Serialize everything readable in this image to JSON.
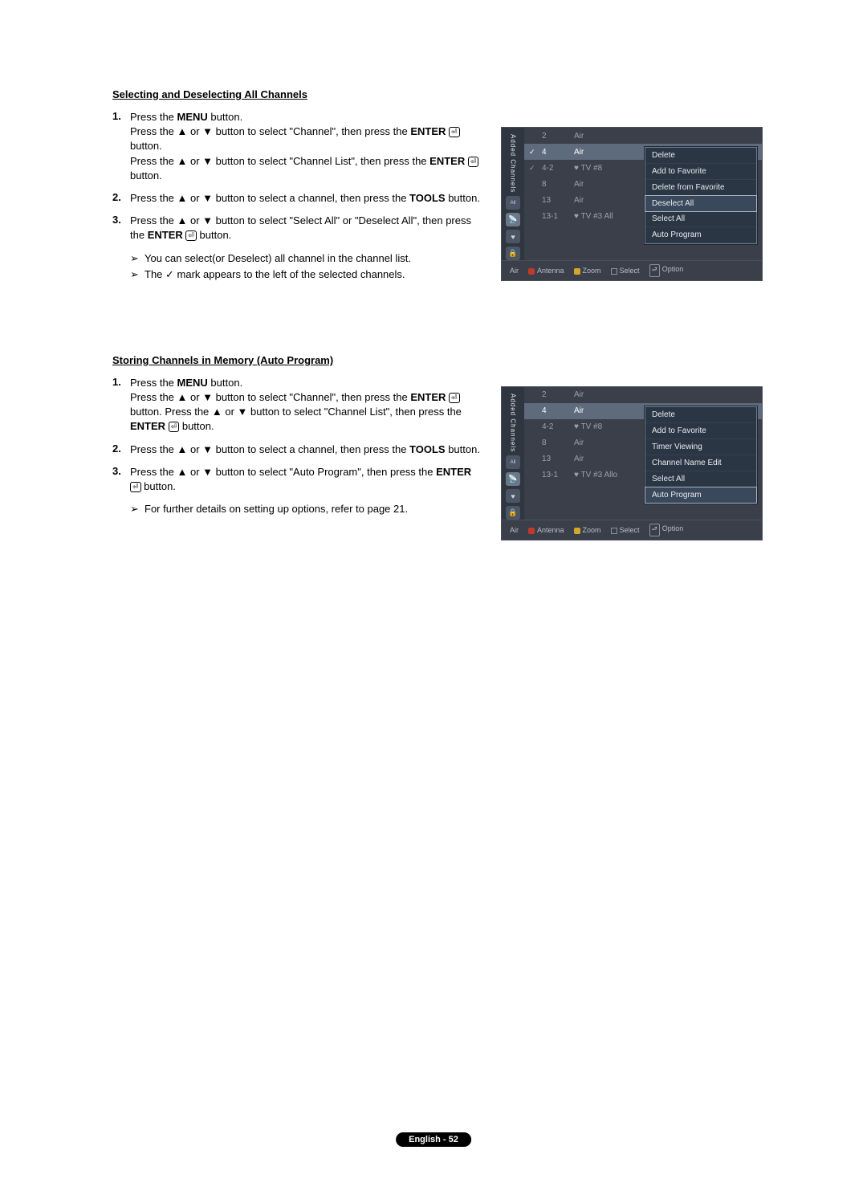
{
  "section1": {
    "heading": "Selecting and Deselecting All Channels",
    "steps": [
      {
        "n": "1.",
        "html": "Press the <b>MENU</b> button.<br>Press the ▲ or ▼ button to select \"Channel\", then press the <b>ENTER</b> <span class='enter-icon'>⏎</span> button.<br>Press the ▲ or ▼ button to select \"Channel List\", then press the <b>ENTER</b> <span class='enter-icon'>⏎</span> button."
      },
      {
        "n": "2.",
        "html": "Press the ▲ or ▼ button to select a channel, then press the <b>TOOLS</b> button."
      },
      {
        "n": "3.",
        "html": "Press the ▲ or ▼ button to select \"Select All\" or \"Deselect All\", then press the <b>ENTER</b> <span class='enter-icon'>⏎</span> button."
      }
    ],
    "notes": [
      "You can select(or Deselect) all channel in the channel list.",
      "The ✓ mark appears to the left of the selected channels."
    ]
  },
  "section2": {
    "heading": "Storing Channels in Memory (Auto Program)",
    "steps": [
      {
        "n": "1.",
        "html": "Press the <b>MENU</b> button.<br>Press the ▲ or ▼ button to select \"Channel\", then press the <b>ENTER</b> <span class='enter-icon'>⏎</span> button. Press the ▲ or ▼ button to select \"Channel List\", then press the <b>ENTER</b> <span class='enter-icon'>⏎</span> button."
      },
      {
        "n": "2.",
        "html": "Press the ▲ or ▼ button to select a channel, then press the <b>TOOLS</b> button."
      },
      {
        "n": "3.",
        "html": "Press the ▲ or ▼ button to select \"Auto Program\", then press the <b>ENTER</b> <span class='enter-icon'>⏎</span> button."
      }
    ],
    "notes": [
      "For further details on setting up options, refer to page 21."
    ]
  },
  "osd": {
    "sideLabel": "Added Channels",
    "channels1": [
      {
        "check": "",
        "num": "2",
        "name": "Air",
        "heart": ""
      },
      {
        "check": "✓",
        "num": "4",
        "name": "Air",
        "heart": "",
        "sel": true
      },
      {
        "check": "✓",
        "num": "4-2",
        "name": "♥ TV #8",
        "heart": ""
      },
      {
        "check": "",
        "num": "8",
        "name": "Air",
        "heart": ""
      },
      {
        "check": "",
        "num": "13",
        "name": "Air",
        "heart": ""
      },
      {
        "check": "",
        "num": "13-1",
        "name": "♥ TV #3   All",
        "heart": ""
      }
    ],
    "channels2": [
      {
        "check": "",
        "num": "2",
        "name": "Air",
        "heart": ""
      },
      {
        "check": "",
        "num": "4",
        "name": "Air",
        "heart": "",
        "sel": true
      },
      {
        "check": "",
        "num": "4-2",
        "name": "♥ TV #8",
        "heart": ""
      },
      {
        "check": "",
        "num": "8",
        "name": "Air",
        "heart": ""
      },
      {
        "check": "",
        "num": "13",
        "name": "Air",
        "heart": ""
      },
      {
        "check": "",
        "num": "13-1",
        "name": "♥ TV #3   Allo",
        "heart": ""
      }
    ],
    "popup1": [
      "Delete",
      "Add to Favorite",
      "Delete from Favorite",
      "Deselect All",
      "Select All",
      "Auto Program"
    ],
    "popup1_hl": 3,
    "popup2": [
      "Delete",
      "Add to Favorite",
      "Timer Viewing",
      "Channel Name Edit",
      "Select All",
      "Auto Program"
    ],
    "popup2_hl": 5,
    "footer": {
      "air": "Air",
      "antenna": "Antenna",
      "zoom": "Zoom",
      "select": "Select",
      "option": "Option"
    }
  },
  "footer": "English - 52"
}
